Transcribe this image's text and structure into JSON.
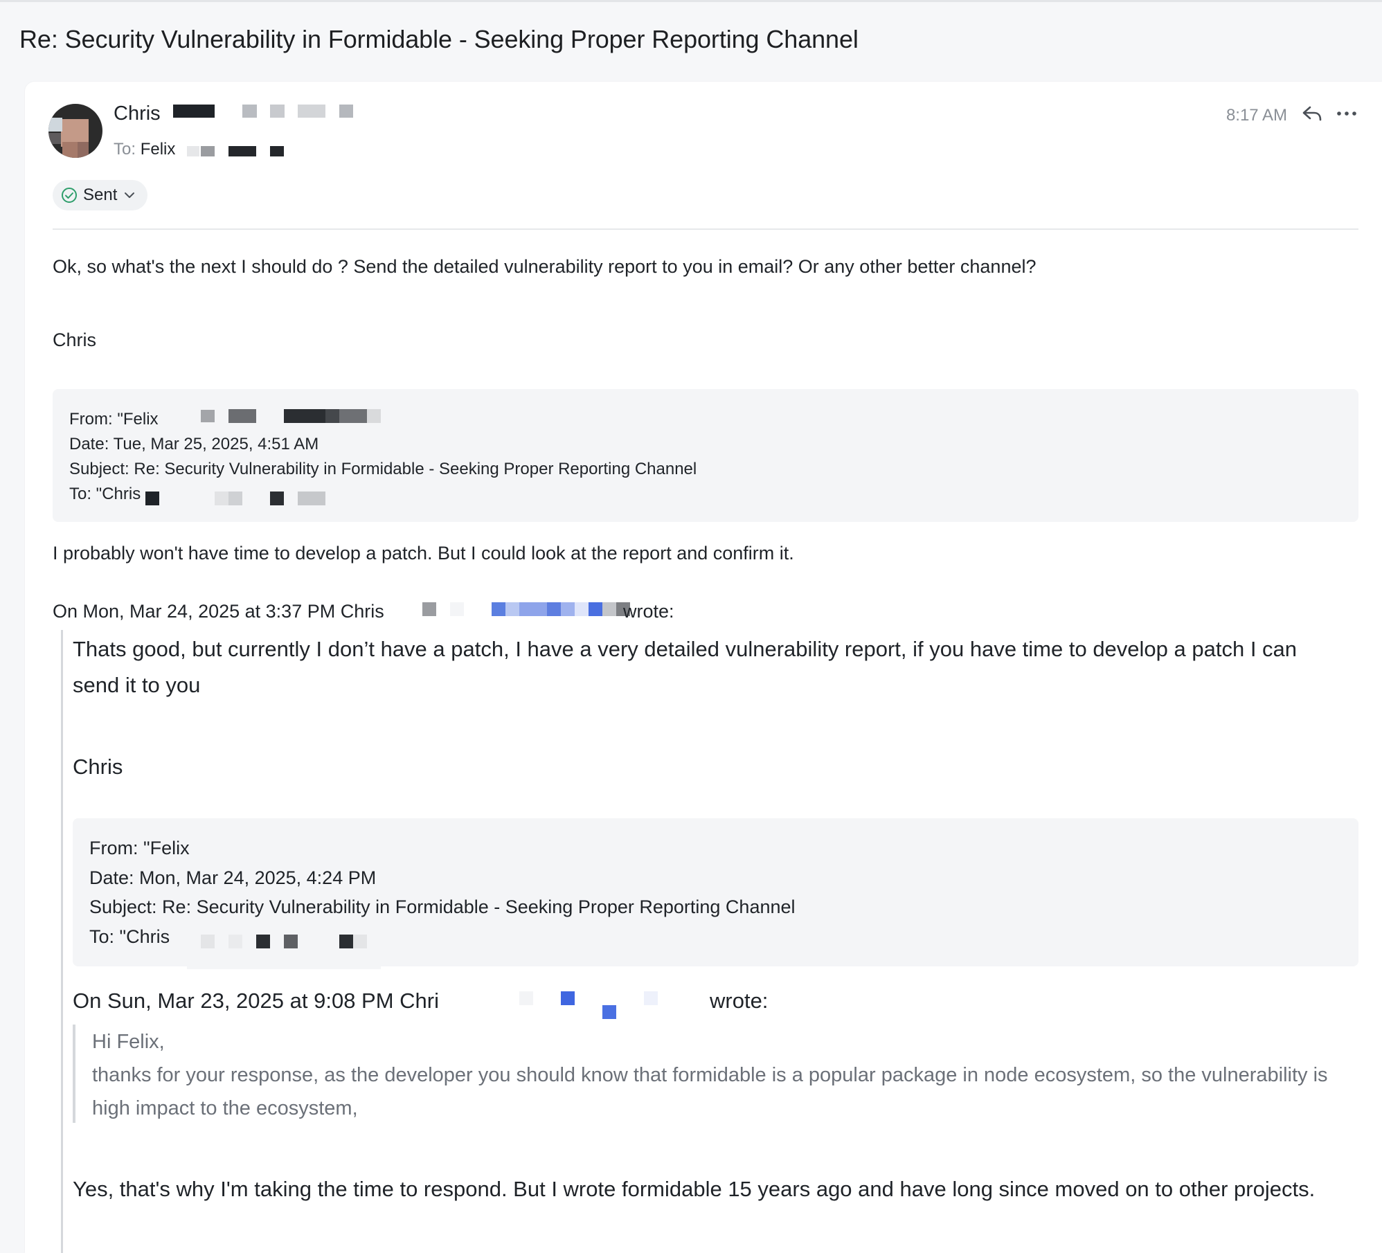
{
  "email": {
    "subject": "Re: Security Vulnerability in Formidable - Seeking Proper Reporting Channel",
    "sender_name": "Chris",
    "to_label": "To:",
    "to_name": "Felix",
    "time": "8:17 AM",
    "status": "Sent",
    "icons": {
      "reply": "reply-icon",
      "more": "more-icon",
      "sent": "check-circle-icon",
      "chevron": "chevron-down-icon"
    }
  },
  "message": {
    "line1": "Ok, so what's the next I should do ? Send the detailed vulnerability report to you in email? Or any other better channel?",
    "signature": "Chris"
  },
  "forward1": {
    "from": "From: \"Felix",
    "date": "Date: Tue, Mar 25, 2025, 4:51 AM",
    "subject": "Subject: Re: Security Vulnerability in Formidable - Seeking Proper Reporting Channel",
    "to": "To: \"Chris"
  },
  "reply1": {
    "text": "I probably won't have time to develop a patch. But I could look at the report and confirm it.",
    "attribution_start": "On Mon, Mar 24, 2025 at 3:37 PM Chris",
    "attribution_end": "wrote:"
  },
  "quoted1": {
    "text": "Thats good, but currently I don’t have a patch, I have a very detailed vulnerability report, if you have time to develop a patch I can send it to you",
    "signature": "Chris"
  },
  "forward2": {
    "from": "From: \"Felix",
    "date": "Date:  Mon, Mar 24, 2025, 4:24 PM",
    "subject": "Subject:  Re: Security Vulnerability in Formidable - Seeking Proper Reporting Channel",
    "to": "To: \"Chris"
  },
  "quoted2": {
    "attribution_start": "On Sun, Mar 23, 2025 at 9:08 PM Chri",
    "attribution_end": "wrote:",
    "greeting": "Hi Felix,",
    "text": "thanks for your response, as the developer you should know that formidable is a popular package in node ecosystem, so the vulnerability is high impact to the ecosystem,",
    "reply": "Yes, that's why I'm taking the time to respond. But I wrote formidable 15 years ago and have long since moved on to other projects."
  }
}
